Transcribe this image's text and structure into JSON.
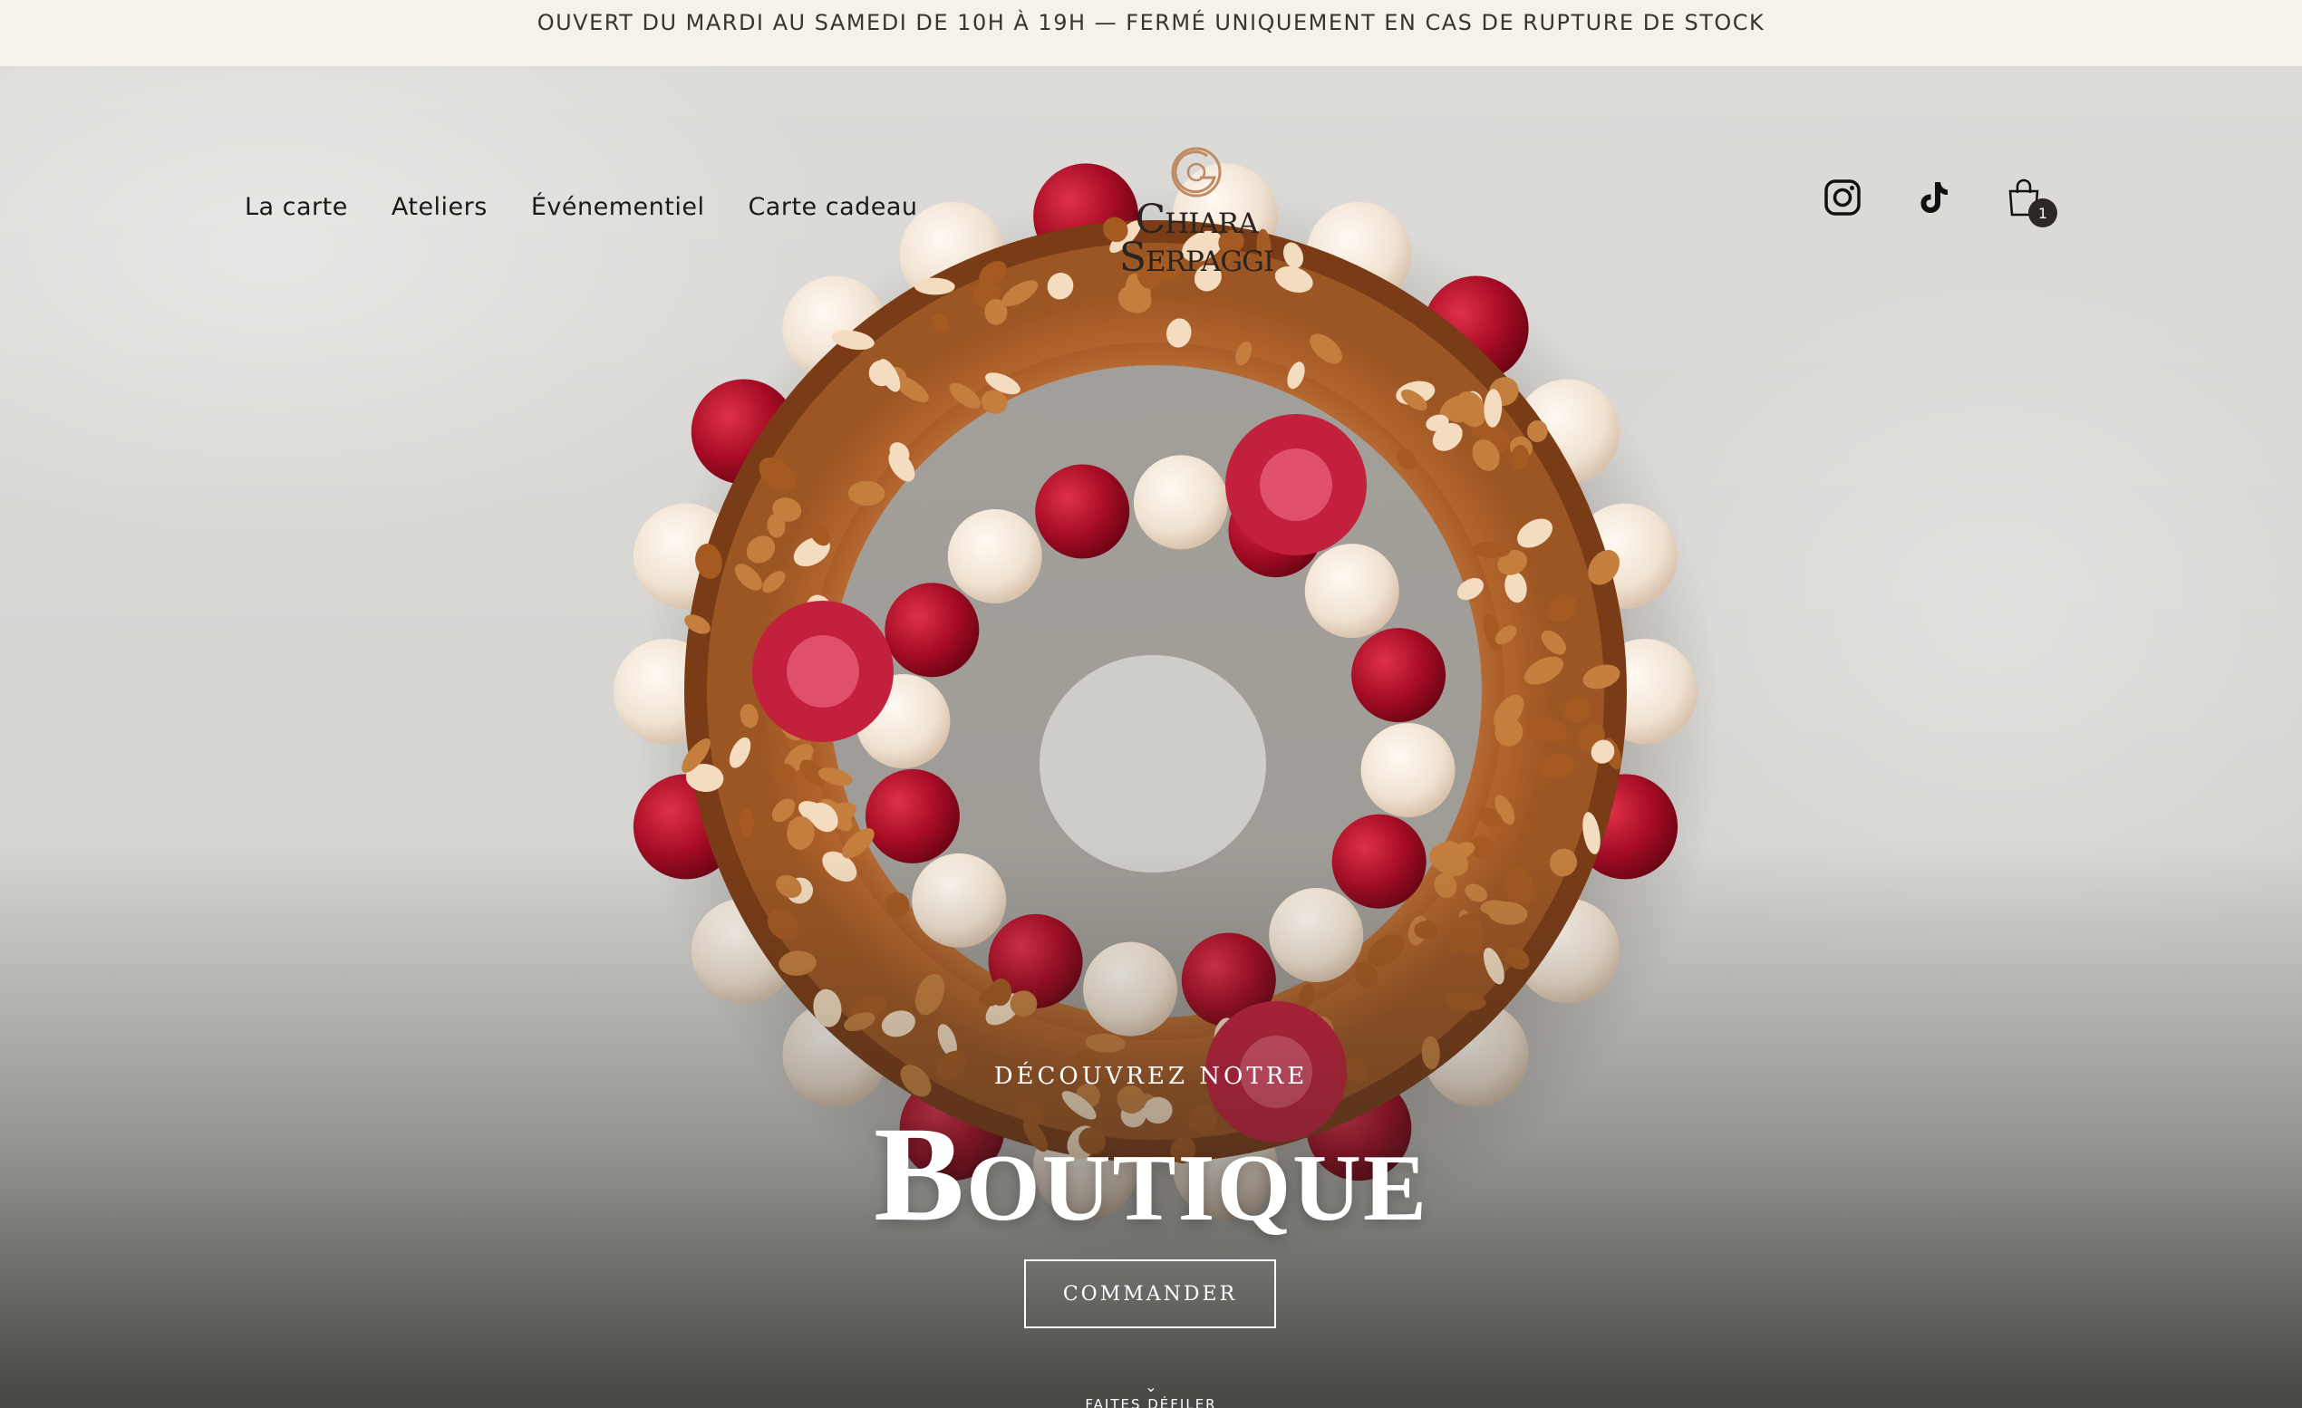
{
  "announcement": "OUVERT DU MARDI AU SAMEDI DE 10H À 19H — FERMÉ UNIQUEMENT EN CAS DE RUPTURE DE STOCK",
  "nav": {
    "items": [
      {
        "label": "La carte"
      },
      {
        "label": "Ateliers"
      },
      {
        "label": "Événementiel"
      },
      {
        "label": "Carte cadeau"
      }
    ]
  },
  "logo": {
    "line1": "Chiara",
    "line2": "Serpaggi"
  },
  "social": {
    "icons": [
      "instagram-icon",
      "tiktok-icon",
      "shopping-bag-icon"
    ]
  },
  "cart": {
    "count": "1"
  },
  "hero": {
    "eyebrow": "DÉCOUVREZ NOTRE",
    "title": "Boutique",
    "cta": "COMMANDER",
    "scroll_label": "FAITES DÉFILER",
    "scroll_glyph": "⌄"
  },
  "colors": {
    "announcement_bg": "#f6f1eb",
    "text_dark": "#1c1a18",
    "logo_gold": "#c08a62",
    "white": "#ffffff"
  }
}
